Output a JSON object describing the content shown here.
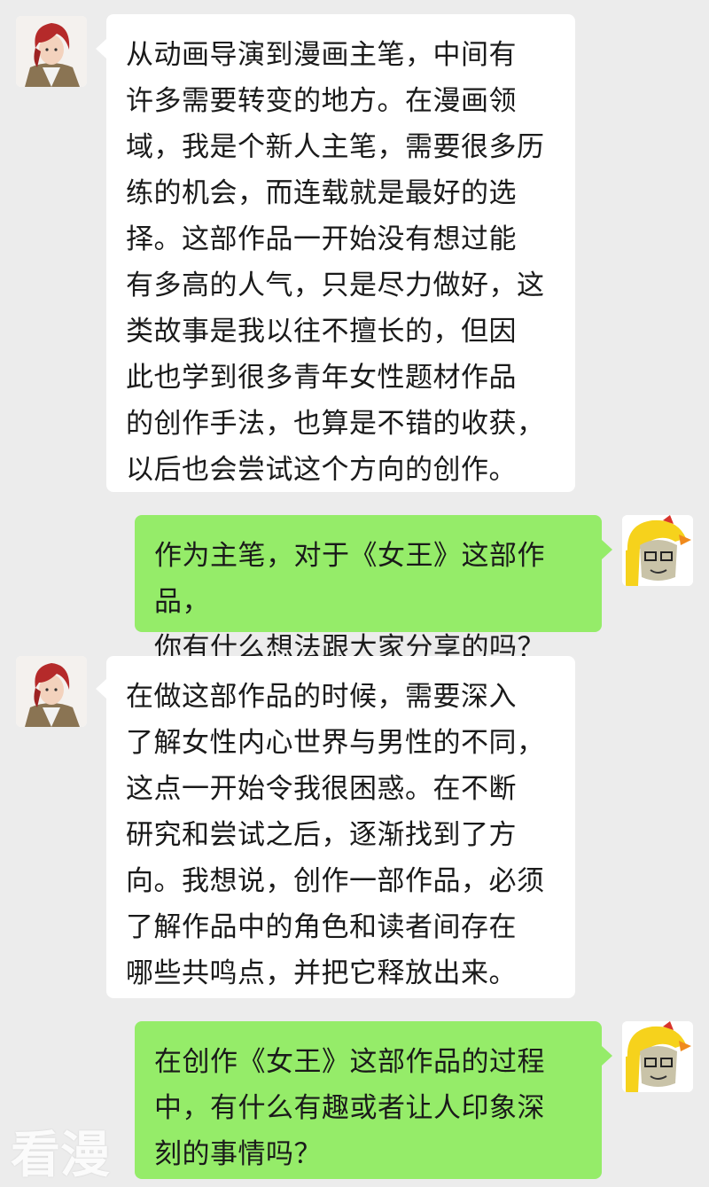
{
  "conversation": {
    "messages": [
      {
        "side": "left",
        "avatar_icon": "red-hair-character-avatar",
        "text": "从动画导演到漫画主笔，中间有\n许多需要转变的地方。在漫画领\n域，我是个新人主笔，需要很多历\n练的机会，而连载就是最好的选\n择。这部作品一开始没有想过能\n有多高的人气，只是尽力做好，这\n类故事是我以往不擅长的，但因\n此也学到很多青年女性题材作品\n的创作手法，也算是不错的收获，\n以后也会尝试这个方向的创作。"
      },
      {
        "side": "right",
        "avatar_icon": "yellow-bird-hat-avatar",
        "text": "作为主笔，对于《女王》这部作品，\n你有什么想法跟大家分享的吗？"
      },
      {
        "side": "left",
        "avatar_icon": "red-hair-character-avatar",
        "text": "在做这部作品的时候，需要深入\n了解女性内心世界与男性的不同，\n这点一开始令我很困惑。在不断\n研究和尝试之后，逐渐找到了方\n向。我想说，创作一部作品，必须\n了解作品中的角色和读者间存在\n哪些共鸣点，并把它释放出来。"
      },
      {
        "side": "right",
        "avatar_icon": "yellow-bird-hat-avatar",
        "text": "在创作《女王》这部作品的过程\n中，有什么有趣或者让人印象深\n刻的事情吗？"
      }
    ]
  },
  "watermark": {
    "text": "看漫"
  },
  "colors": {
    "background": "#ececec",
    "left_bubble": "#ffffff",
    "right_bubble": "#95ec69"
  }
}
